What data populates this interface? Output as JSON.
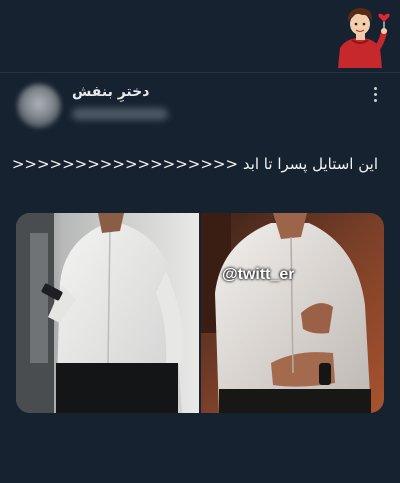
{
  "tweet": {
    "author_name": "دخترِ بنفش",
    "text": "این استایل پسرا تا ابد <<<<<<<<<<<<<<<<<<",
    "watermark": "@twitt_er"
  },
  "icons": {
    "menu": "more-vertical-icon",
    "sticker": "boy-with-heart-sticker"
  },
  "colors": {
    "background": "#172230",
    "text": "#e7e9ea",
    "sticker_red": "#c6282b"
  }
}
